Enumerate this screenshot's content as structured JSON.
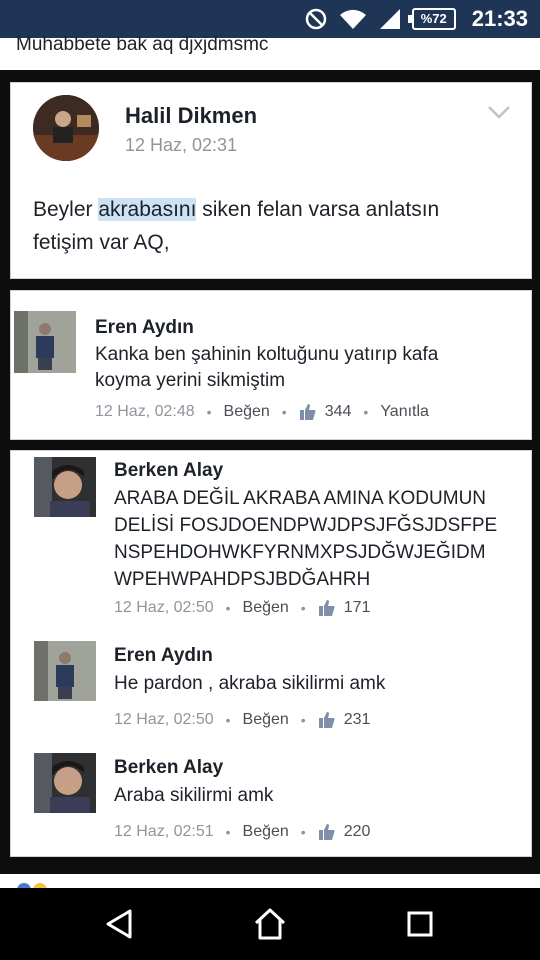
{
  "status_bar": {
    "time": "21:33",
    "battery": "%72",
    "icons": [
      "dnd-icon",
      "wifi-icon",
      "signal-icon",
      "battery-icon"
    ]
  },
  "header_text": "Muhabbete bak aq djxjdmsmc",
  "post": {
    "author": "Halil Dikmen",
    "time": "12 Haz, 02:31",
    "text_before": "Beyler ",
    "text_highlight": "akrabasını",
    "text_after": " siken felan varsa anlatsın",
    "text_line2": "fetişim var AQ,"
  },
  "comments": [
    {
      "author": "Eren Aydın",
      "text_lines": [
        "Kanka ben şahinin koltuğunu yatırıp kafa",
        "koyma yerini sikmiştim"
      ],
      "time": "12 Haz, 02:48",
      "like_label": "Beğen",
      "likes": "344",
      "reply_label": "Yanıtla"
    },
    {
      "author": "Berken Alay",
      "text_lines": [
        "ARABA DEĞİL AKRABA AMINA KODUMUN",
        "DELİSİ FOSJDOENDPWJDPSJFĞSJDSFPE",
        "NSPEHDOHWKFYRNMXPSJDĞWJEĞIDM",
        "WPEHWPAHDPSJBDĞAHRH"
      ],
      "time": "12 Haz, 02:50",
      "like_label": "Beğen",
      "likes": "171"
    },
    {
      "author": "Eren Aydın",
      "text_lines": [
        "He pardon , akraba sikilirmi amk"
      ],
      "time": "12 Haz, 02:50",
      "like_label": "Beğen",
      "likes": "231"
    },
    {
      "author": "Berken Alay",
      "text_lines": [
        "Araba sikilirmi amk"
      ],
      "time": "12 Haz, 02:51",
      "like_label": "Beğen",
      "likes": "220"
    }
  ],
  "colors": {
    "status_bar": "#1f3556",
    "name": "#1d2129",
    "meta": "#90949c",
    "highlight": "#cde3f5"
  }
}
